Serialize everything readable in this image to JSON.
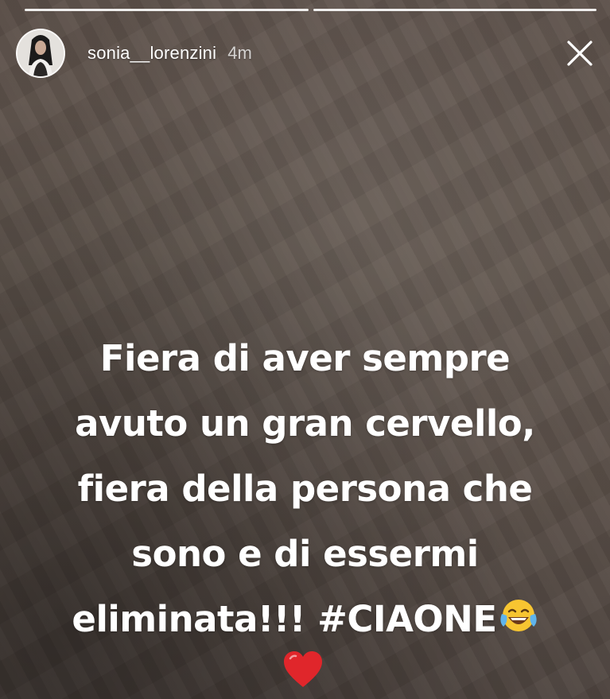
{
  "story": {
    "progress": [
      {
        "state": "viewed"
      },
      {
        "state": "active"
      }
    ],
    "header": {
      "username": "sonia__lorenzini",
      "time": "4m",
      "close_icon": "close-icon"
    },
    "caption": {
      "lines": [
        "Fiera di aver sempre",
        "avuto un gran cervello,",
        "fiera della persona che",
        "sono e di essermi",
        "eliminata!!! #CIAONE"
      ],
      "laugh_emoji": "face-with-tears-of-joy-icon",
      "heart_emoji": "red-heart-icon"
    },
    "colors": {
      "text": "#ffffff",
      "heart": "#e0262b",
      "emoji_face": "#f7c531"
    }
  }
}
